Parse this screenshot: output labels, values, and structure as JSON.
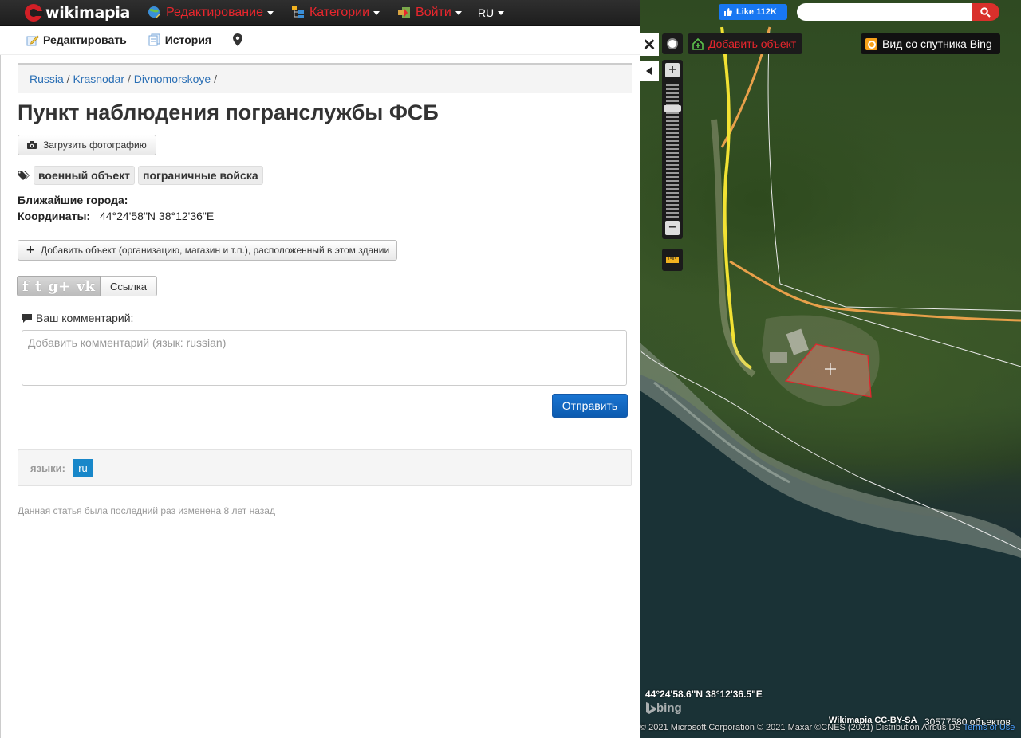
{
  "topbar": {
    "logo_text": "wikimapia",
    "menu": [
      {
        "label": "Редактирование",
        "icon": "edit-globe-icon"
      },
      {
        "label": "Категории",
        "icon": "categories-icon"
      },
      {
        "label": "Войти",
        "icon": "login-icon"
      }
    ],
    "language": "RU"
  },
  "subbar": {
    "edit_label": "Редактировать",
    "history_label": "История"
  },
  "breadcrumb": [
    "Russia",
    "Krasnodar",
    "Divnomorskoye"
  ],
  "page_title": "Пункт наблюдения погранслужбы ФСБ",
  "upload_photo_label": "Загрузить фотографию",
  "tags": [
    "военный объект",
    "пограничные войска"
  ],
  "nearest_cities_label": "Ближайшие города:",
  "coordinates": {
    "label": "Координаты:",
    "value": "44°24'58\"N 38°12'36\"E"
  },
  "add_object_in_building_label": "Добавить объект (организацию, магазин и т.п.), расположенный в этом здании",
  "share": {
    "icons": [
      "facebook-icon",
      "twitter-icon",
      "google-plus-icon",
      "vk-icon"
    ],
    "link_label": "Ссылка"
  },
  "comment": {
    "label": "Ваш комментарий:",
    "placeholder": "Добавить комментарий (язык: russian)",
    "submit_label": "Отправить"
  },
  "languages": {
    "label": "языки:",
    "items": [
      "ru"
    ]
  },
  "last_modified": "Данная статья была последний раз изменена 8 лет назад",
  "map": {
    "fb_like_label": "Like 112K",
    "search_placeholder": "",
    "add_object_label": "Добавить объект",
    "satellite_view_label": "Вид со спутника Bing",
    "cursor_coords": "44°24'58.6\"N 38°12'36.5\"E",
    "bing_logo": "bing",
    "license": "Wikimapia CC-BY-SA",
    "object_count": "30577580 объектов",
    "copyright": "© 2021 Microsoft Corporation © 2021 Maxar ©CNES (2021) Distribution Airbus DS",
    "terms_label": "Terms of Use",
    "colors": {
      "road_yellow": "#f2e233",
      "road_orange": "#e8a04a",
      "polygon_red": "#e0262d"
    }
  },
  "colors": {
    "accent_red": "#e8262d",
    "link_blue": "#2a6fb5",
    "button_blue": "#1a75d2"
  }
}
